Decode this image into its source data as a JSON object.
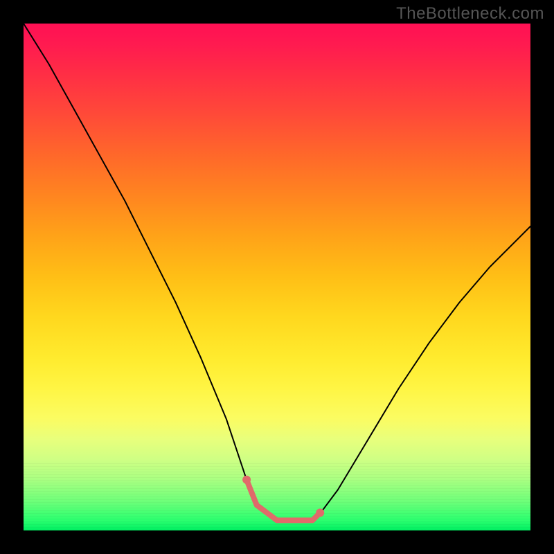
{
  "watermark": "TheBottleneck.com",
  "chart_data": {
    "type": "line",
    "title": "",
    "xlabel": "",
    "ylabel": "",
    "xlim": [
      0,
      100
    ],
    "ylim": [
      0,
      100
    ],
    "series": [
      {
        "name": "main-curve",
        "x": [
          0,
          5,
          10,
          15,
          20,
          25,
          30,
          35,
          40,
          44,
          46,
          50,
          54,
          57,
          59,
          62,
          68,
          74,
          80,
          86,
          92,
          98,
          100
        ],
        "values": [
          100,
          92,
          83,
          74,
          65,
          55,
          45,
          34,
          22,
          10,
          5,
          2,
          2,
          2,
          4,
          8,
          18,
          28,
          37,
          45,
          52,
          58,
          60
        ]
      }
    ],
    "trough_segment": {
      "x": [
        44,
        46,
        50,
        54,
        57,
        58.5
      ],
      "values": [
        10,
        5,
        2,
        2,
        2,
        3.5
      ],
      "color": "#e06a6a",
      "width": 8
    },
    "endpoints": [
      {
        "x": 44.0,
        "y": 10.0,
        "r": 6,
        "color": "#e06a6a"
      },
      {
        "x": 58.5,
        "y": 3.5,
        "r": 6,
        "color": "#e06a6a"
      }
    ],
    "background": {
      "gradient_stops": [
        {
          "pos": 0.0,
          "color": "#ff1054"
        },
        {
          "pos": 0.5,
          "color": "#ffbf16"
        },
        {
          "pos": 0.8,
          "color": "#f3ff6e"
        },
        {
          "pos": 1.0,
          "color": "#00ef62"
        }
      ]
    }
  }
}
